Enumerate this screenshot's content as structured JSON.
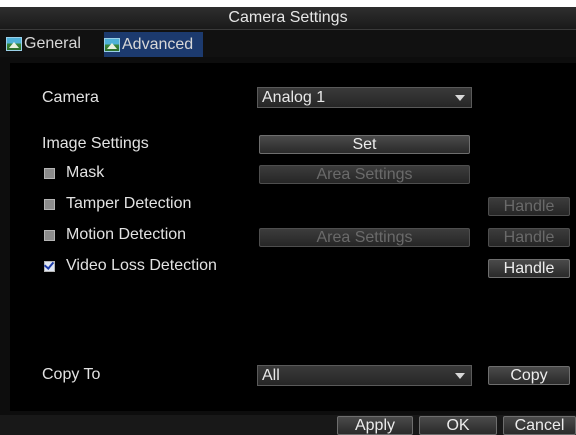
{
  "window": {
    "title": "Camera Settings"
  },
  "tabs": [
    {
      "label": "General",
      "icon": "landscape-icon"
    },
    {
      "label": "Advanced",
      "icon": "landscape-icon",
      "active": true
    }
  ],
  "settings": {
    "camera": {
      "label": "Camera",
      "value": "Analog 1"
    },
    "image_settings": {
      "label": "Image Settings",
      "button": "Set"
    },
    "mask": {
      "label": "Mask",
      "checked": false,
      "button": "Area Settings"
    },
    "tamper": {
      "label": "Tamper Detection",
      "checked": false,
      "button": "Handle"
    },
    "motion": {
      "label": "Motion Detection",
      "checked": false,
      "area_button": "Area Settings",
      "handle_button": "Handle"
    },
    "video_loss": {
      "label": "Video Loss Detection",
      "checked": true,
      "button": "Handle"
    },
    "copy_to": {
      "label": "Copy To",
      "value": "All",
      "button": "Copy"
    }
  },
  "footer": {
    "apply": "Apply",
    "ok": "OK",
    "cancel": "Cancel"
  },
  "colors": {
    "tab_active": "#1c3a6e",
    "background": "#000000"
  }
}
